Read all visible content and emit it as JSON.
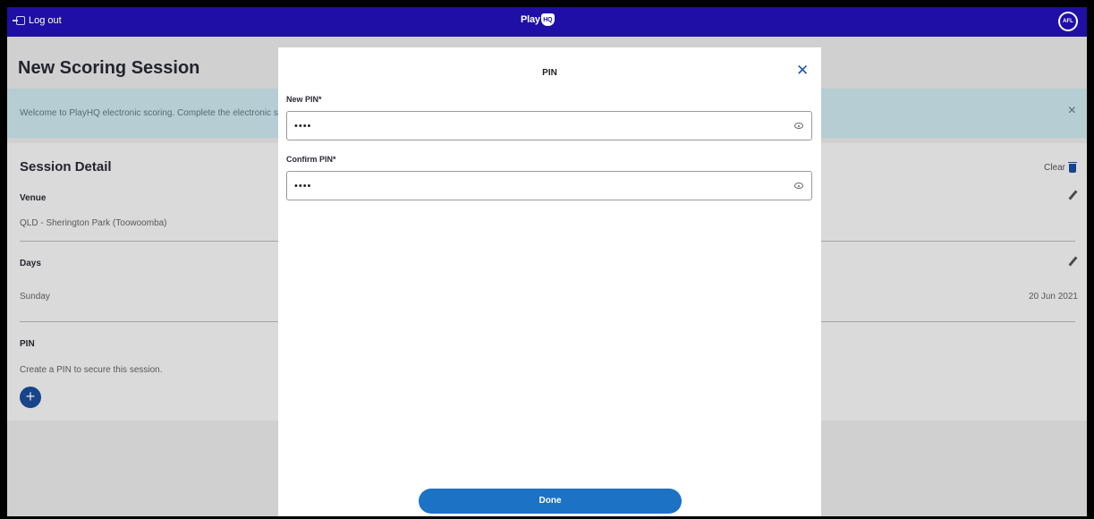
{
  "topbar": {
    "logout_label": "Log out",
    "brand_text": "Play",
    "brand_mark": "HQ",
    "partner_logo": "AFL"
  },
  "page": {
    "title": "New Scoring Session",
    "banner_text": "Welcome to PlayHQ electronic scoring. Complete the electronic s",
    "session": {
      "title": "Session Detail",
      "clear_label": "Clear",
      "venue_label": "Venue",
      "venue_value": "QLD - Sherington Park (Toowoomba)",
      "days_label": "Days",
      "day_name": "Sunday",
      "day_date": "20 Jun 2021",
      "pin_label": "PIN",
      "pin_hint": "Create a PIN to secure this session."
    }
  },
  "modal": {
    "title": "PIN",
    "new_pin_label": "New PIN*",
    "new_pin_value": "1234",
    "confirm_pin_label": "Confirm PIN*",
    "confirm_pin_value": "1234",
    "done_label": "Done"
  },
  "icons": {
    "close": "close-icon",
    "eye": "eye-icon",
    "trash": "trash-icon",
    "pencil": "pencil-icon",
    "plus": "plus-icon",
    "logout": "logout-icon"
  },
  "colors": {
    "topbar": "#1f0fa6",
    "primary": "#1c72c4",
    "banner": "#cfeaf1"
  }
}
